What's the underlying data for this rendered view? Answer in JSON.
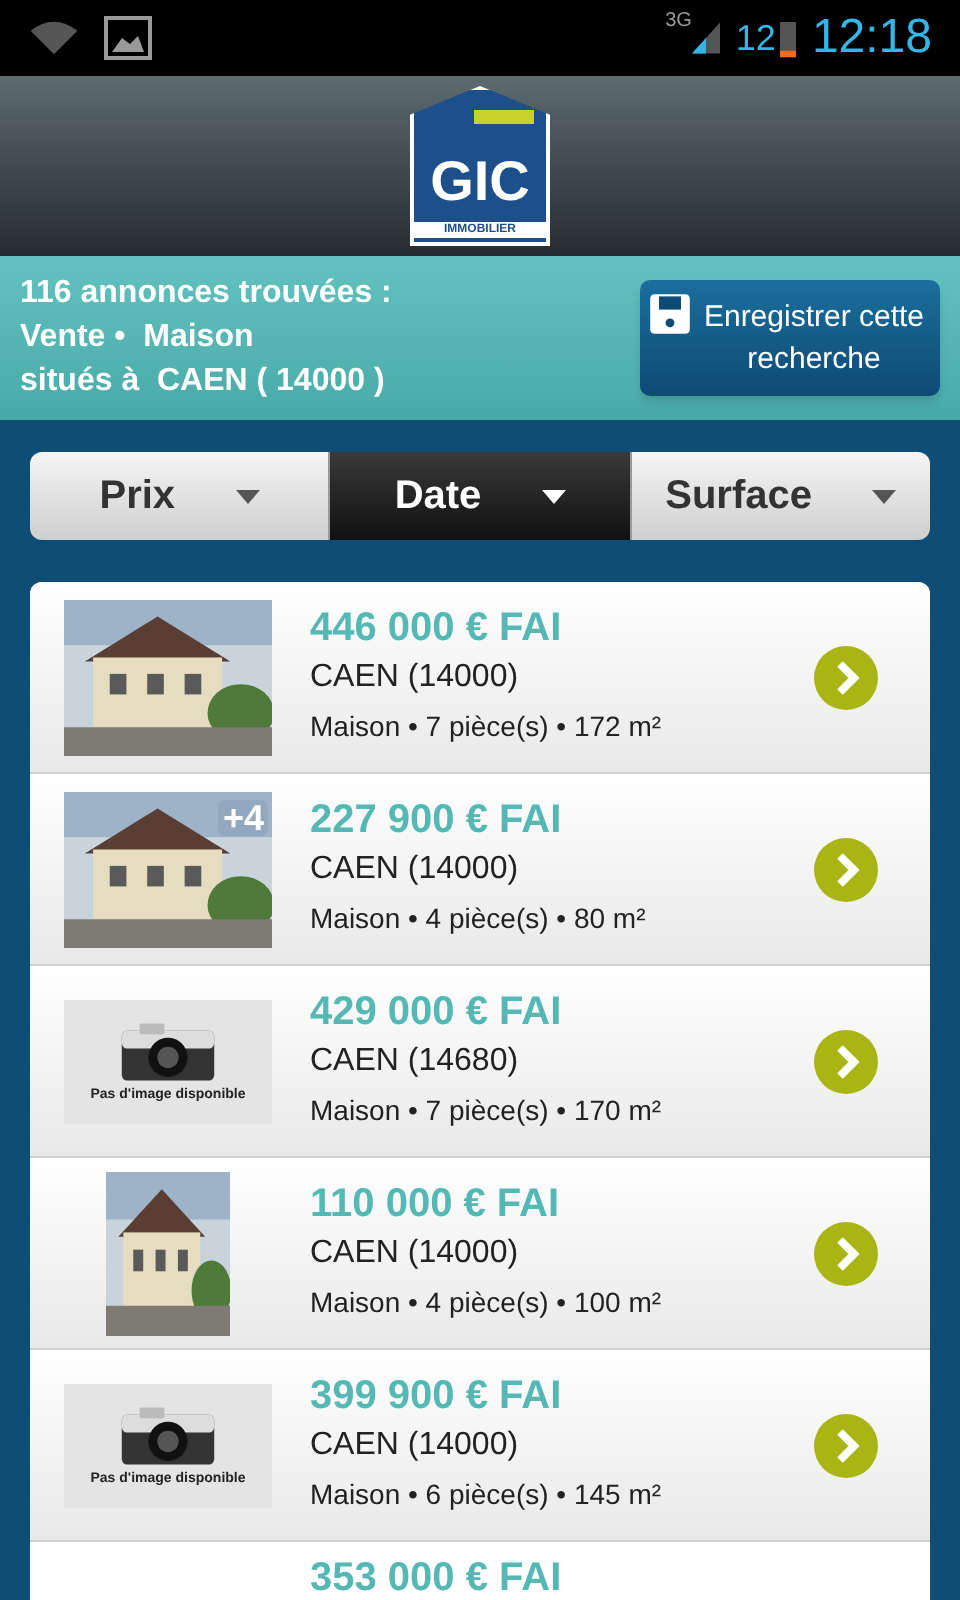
{
  "status_bar": {
    "network": "3G",
    "battery_percent": "12",
    "time": "12:18"
  },
  "header": {
    "logo_text": "GIC",
    "logo_subtext": "IMMOBILIER"
  },
  "summary": {
    "lines": [
      "116 annonces trouvées :",
      "Vente •  Maison",
      "situés à  CAEN ( 14000 )"
    ],
    "save_button": "Enregistrer cette recherche"
  },
  "sort_tabs": [
    {
      "label": "Prix",
      "selected": false
    },
    {
      "label": "Date",
      "selected": true
    },
    {
      "label": "Surface",
      "selected": false
    }
  ],
  "listings": [
    {
      "price": "446 000 € FAI",
      "city": "CAEN (14000)",
      "details": "Maison • 7 pièce(s) • 172 m²"
    },
    {
      "thumbnail": {
        "badge": "+4"
      },
      "price": "227 900 € FAI",
      "city": "CAEN (14000)",
      "details": "Maison • 4 pièce(s) • 80 m²"
    },
    {
      "thumbnail": {
        "kind": "no_image",
        "caption": "Pas d'image disponible"
      },
      "price": "429 000 € FAI",
      "city": "CAEN (14680)",
      "details": "Maison • 7 pièce(s) • 170 m²"
    },
    {
      "thumbnail": {
        "kind": "photo_portrait"
      },
      "price": "110 000 € FAI",
      "city": "CAEN (14000)",
      "details": "Maison • 4 pièce(s) • 100 m²"
    },
    {
      "thumbnail": {
        "kind": "no_image",
        "caption": "Pas d'image disponible"
      },
      "price": "399 900 € FAI",
      "city": "CAEN (14000)",
      "details": "Maison • 6 pièce(s) • 145 m²"
    },
    {
      "price": "353 000 € FAI"
    }
  ]
}
